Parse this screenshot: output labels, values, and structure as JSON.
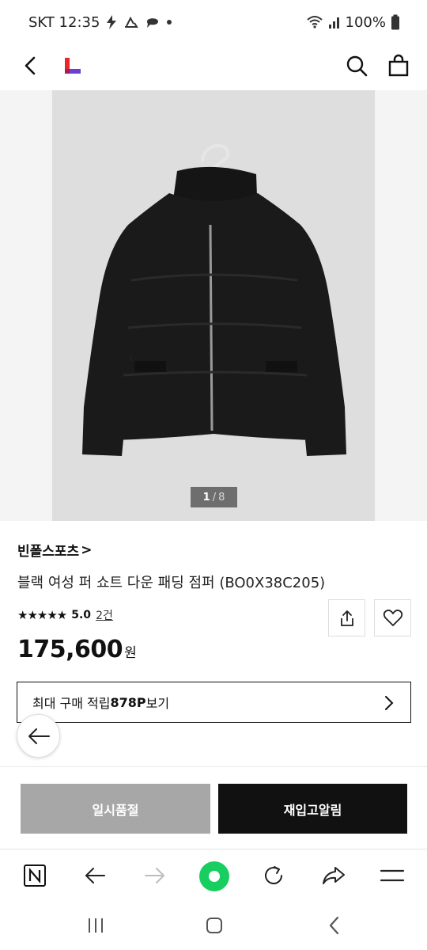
{
  "status_bar": {
    "carrier_time": "SKT 12:35",
    "battery": "100%",
    "icons": [
      "flash-icon",
      "recycle-icon",
      "chat-bubble-icon",
      "dot-icon",
      "wifi-icon",
      "signal-icon",
      "battery-icon"
    ]
  },
  "header": {
    "icons": [
      "back-arrow-icon",
      "brand-logo-icon",
      "search-icon",
      "shopping-bag-icon"
    ]
  },
  "gallery": {
    "current": "1",
    "separator": "/",
    "total": "8"
  },
  "product": {
    "brand": "빈폴스포츠",
    "brand_chevron": ">",
    "title": "블랙 여성 퍼 쇼트 다운 패딩 점퍼 (BO0X38C205)",
    "stars": "★★★★★",
    "rating": "5.0",
    "reviews": "2건",
    "price": "175,600",
    "currency": "원"
  },
  "points_box": {
    "prefix": "최대 구매 적립 ",
    "amount": "878P",
    "suffix": "보기"
  },
  "actions": {
    "sold_out": "일시품절",
    "restock_notify": "재입고알림"
  },
  "colors": {
    "sold_out_bg": "#a7a7a7",
    "notify_bg": "#111111",
    "browser_green": "#19ce60",
    "logo_red": "#e8262b",
    "logo_purple": "#6b3fd4"
  }
}
